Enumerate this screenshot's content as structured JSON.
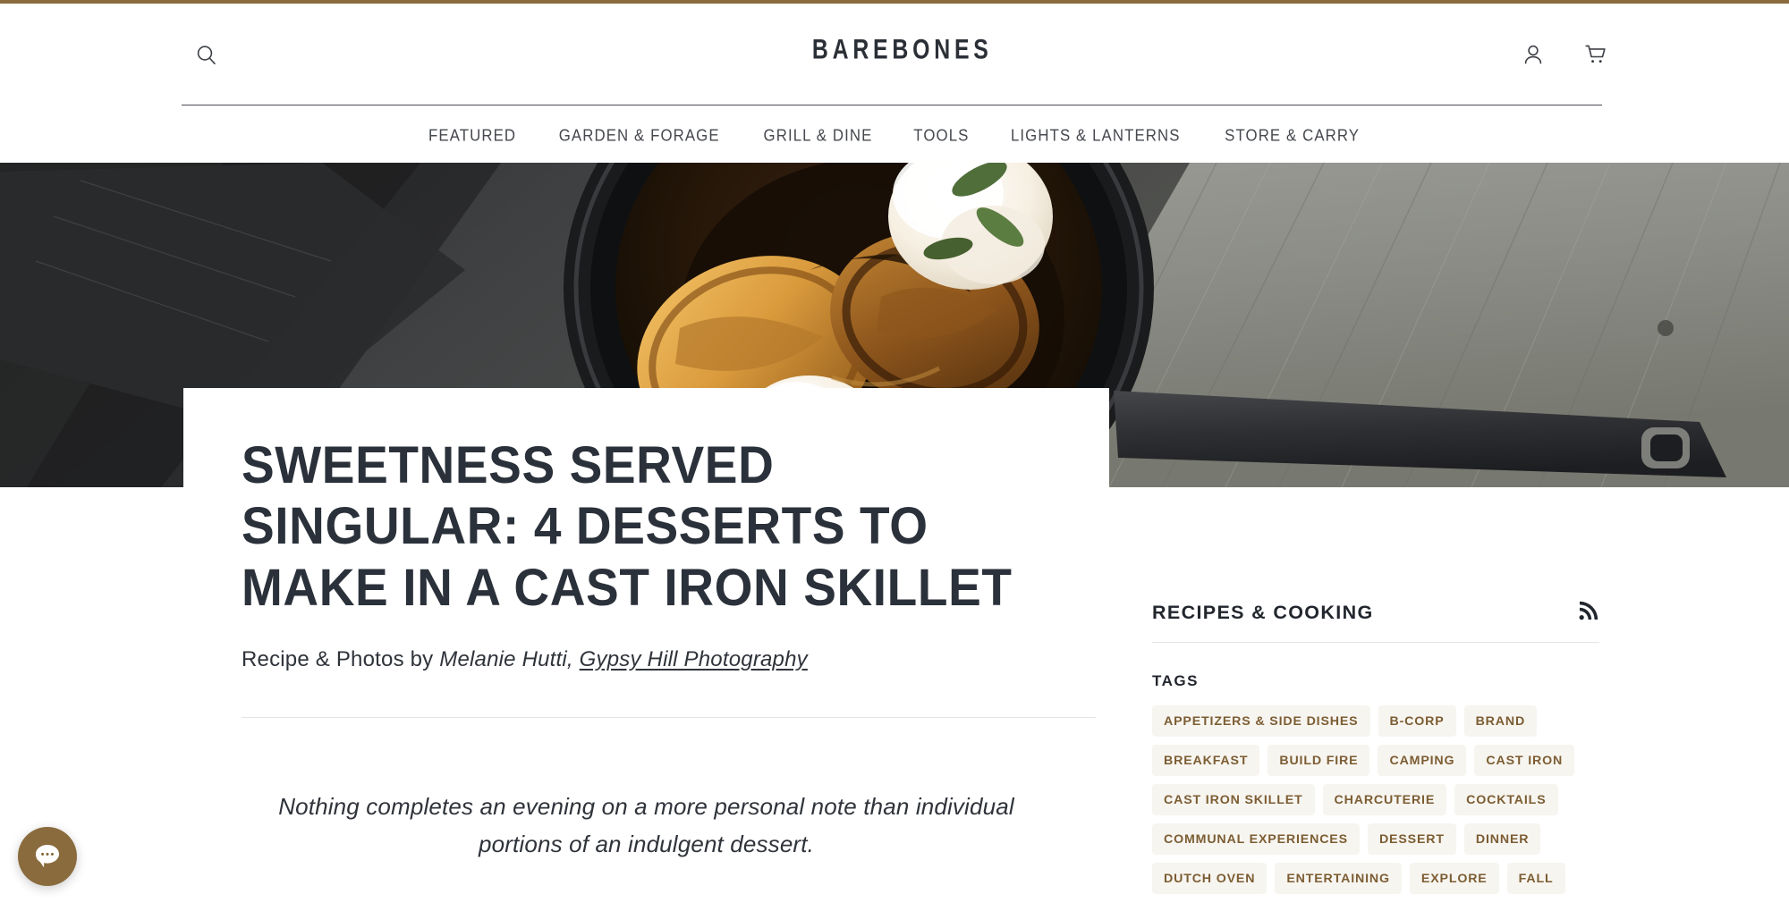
{
  "theme": {
    "accent_gold": "#8a6b3d",
    "tag_text": "#7c5d33",
    "tag_bg": "#f7f5f0",
    "ink": "#2b313a"
  },
  "header": {
    "logo": "BAREBONES",
    "search_icon": "search-icon",
    "account_icon": "account-icon",
    "cart_icon": "cart-icon"
  },
  "nav": {
    "items": [
      {
        "label": "FEATURED"
      },
      {
        "label": "GARDEN & FORAGE"
      },
      {
        "label": "GRILL & DINE"
      },
      {
        "label": "TOOLS"
      },
      {
        "label": "LIGHTS & LANTERNS"
      },
      {
        "label": "STORE & CARRY"
      }
    ]
  },
  "hero": {
    "alt": "Cast iron skillet with grilled peaches, whipped cream and mint on weathered wood"
  },
  "article": {
    "title": "SWEETNESS SERVED SINGULAR: 4 DESSERTS TO MAKE IN A CAST IRON SKILLET",
    "byline_prefix": "Recipe & Photos by ",
    "byline_author": "Melanie Hutti,",
    "byline_link": "Gypsy Hill Photography",
    "pull_quote": "Nothing completes an evening on a more personal note than individual portions of an indulgent dessert."
  },
  "sidebar": {
    "title": "RECIPES & COOKING",
    "rss_icon": "rss-icon",
    "tags_label": "TAGS",
    "tags": [
      {
        "label": "APPETIZERS & SIDE DISHES"
      },
      {
        "label": "B-CORP"
      },
      {
        "label": "BRAND"
      },
      {
        "label": "BREAKFAST"
      },
      {
        "label": "BUILD FIRE"
      },
      {
        "label": "CAMPING"
      },
      {
        "label": "CAST IRON"
      },
      {
        "label": "CAST IRON SKILLET"
      },
      {
        "label": "CHARCUTERIE"
      },
      {
        "label": "COCKTAILS"
      },
      {
        "label": "COMMUNAL EXPERIENCES"
      },
      {
        "label": "DESSERT"
      },
      {
        "label": "DINNER"
      },
      {
        "label": "DUTCH OVEN"
      },
      {
        "label": "ENTERTAINING"
      },
      {
        "label": "EXPLORE"
      },
      {
        "label": "FALL"
      }
    ]
  },
  "chat": {
    "icon": "chat-bubble-icon"
  }
}
